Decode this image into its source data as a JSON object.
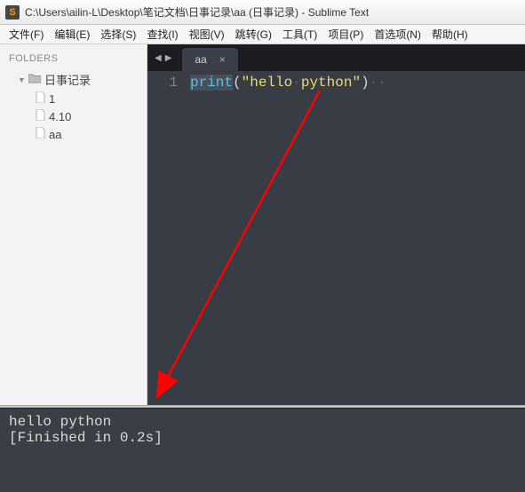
{
  "window": {
    "title": "C:\\Users\\ailin-L\\Desktop\\笔记文档\\日事记录\\aa (日事记录) - Sublime Text"
  },
  "menu": {
    "items": [
      "文件(F)",
      "编辑(E)",
      "选择(S)",
      "查找(I)",
      "视图(V)",
      "跳转(G)",
      "工具(T)",
      "项目(P)",
      "首选项(N)",
      "帮助(H)"
    ]
  },
  "sidebar": {
    "heading": "FOLDERS",
    "root": "日事记录",
    "files": [
      "1",
      "4.10",
      "aa"
    ]
  },
  "tabs": {
    "active": "aa"
  },
  "editor": {
    "line_number": "1",
    "code": {
      "fn": "print",
      "open": "(",
      "str": "\"hello python\"",
      "close": ")",
      "ws_marker": "·",
      "trail": "··"
    }
  },
  "console": {
    "line1": "hello python",
    "line2": "[Finished in 0.2s]"
  }
}
